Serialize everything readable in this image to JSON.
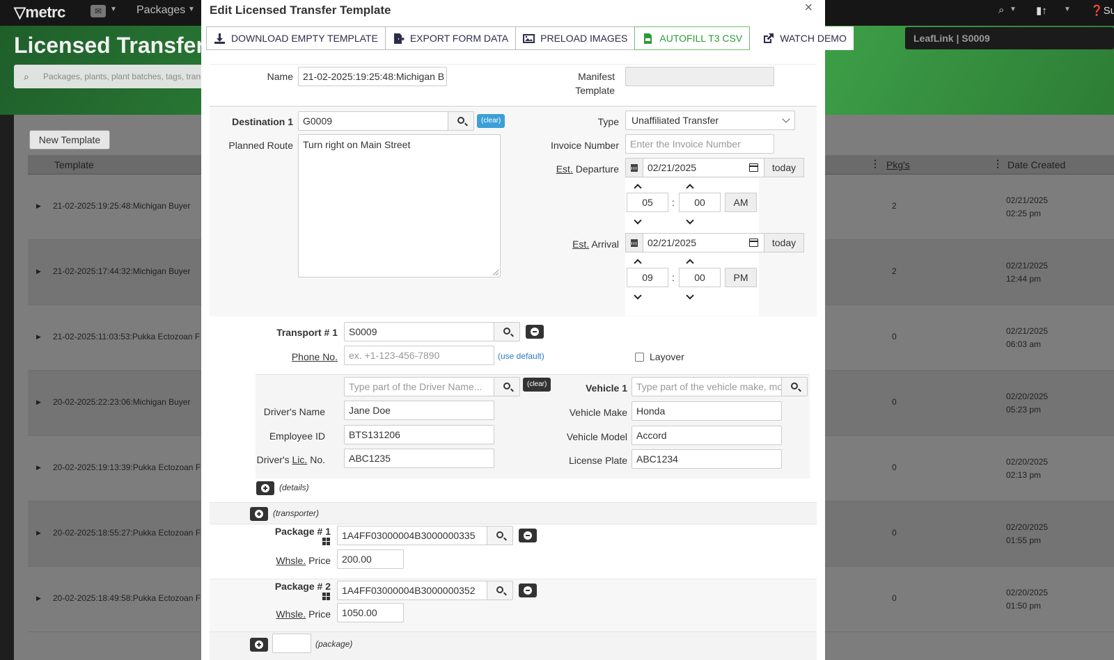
{
  "app": {
    "logo": "metrc",
    "nav_packages": "Packages",
    "page_title": "Licensed Transfer",
    "search_placeholder": "Packages, plants, plant batches, tags, transfers",
    "facility": "LeafLink | S0009",
    "user_short": "Su"
  },
  "grid": {
    "new_template_label": "New Template",
    "col_template": "Template",
    "col_pkgs": "Pkg's",
    "col_date_created": "Date Created",
    "rows": [
      {
        "name": "21-02-2025:19:25:48:Michigan Buyer",
        "pkgs": "2",
        "date": "02/21/2025",
        "time": "02:25 pm"
      },
      {
        "name": "21-02-2025:17:44:32:Michigan Buyer",
        "pkgs": "2",
        "date": "02/21/2025",
        "time": "12:44 pm"
      },
      {
        "name": "21-02-2025:11:03:53:Pukka Ectozoan F",
        "pkgs": "0",
        "date": "02/21/2025",
        "time": "06:03 am"
      },
      {
        "name": "20-02-2025:22:23:06:Michigan Buyer",
        "pkgs": "0",
        "date": "02/20/2025",
        "time": "05:23 pm"
      },
      {
        "name": "20-02-2025:19:13:39:Pukka Ectozoan F",
        "pkgs": "0",
        "date": "02/20/2025",
        "time": "02:13 pm"
      },
      {
        "name": "20-02-2025:18:55:27:Pukka Ectozoan F",
        "pkgs": "0",
        "date": "02/20/2025",
        "time": "01:55 pm"
      },
      {
        "name": "20-02-2025:18:49:58:Pukka Ectozoan F",
        "pkgs": "0",
        "date": "02/20/2025",
        "time": "01:50 pm"
      }
    ]
  },
  "modal": {
    "title": "Edit Licensed Transfer Template",
    "close": "×",
    "toolbar": {
      "download": "DOWNLOAD EMPTY TEMPLATE",
      "export": "EXPORT FORM DATA",
      "preload": "PRELOAD IMAGES",
      "autofill": "AUTOFILL T3 CSV",
      "watch": "WATCH DEMO"
    },
    "name_label": "Name",
    "name_value": "21-02-2025:19:25:48:Michigan B",
    "manifest_label_1": "Manifest",
    "manifest_label_2": "Template",
    "destination_label": "Destination 1",
    "destination_value": "G0009",
    "clear": "(clear)",
    "type_label": "Type",
    "type_value": "Unaffiliated Transfer",
    "route_label": "Planned Route",
    "route_value": "Turn right on Main Street",
    "invoice_label": "Invoice Number",
    "invoice_placeholder": "Enter the Invoice Number",
    "departure_label_ab": "Est.",
    "departure_label": "Departure",
    "departure_date": "02/21/2025",
    "today": "today",
    "dep_hour": "05",
    "dep_min": "00",
    "dep_ampm": "AM",
    "arrival_label": "Arrival",
    "arrival_date": "02/21/2025",
    "arr_hour": "09",
    "arr_min": "00",
    "arr_ampm": "PM",
    "colon": ":",
    "transport_label": "Transport # 1",
    "transport_value": "S0009",
    "phone_label": "Phone No.",
    "phone_placeholder": "ex. +1-123-456-7890",
    "use_default": "(use default)",
    "layover": "Layover",
    "driver_search_placeholder": "Type part of the Driver Name...",
    "vehicle_label": "Vehicle 1",
    "vehicle_search_placeholder": "Type part of the vehicle make, model",
    "driver_name_label": "Driver's Name",
    "driver_name_value": "Jane Doe",
    "employee_id_label": "Employee ID",
    "employee_id_value": "BTS131206",
    "lic_label_a": "Driver's",
    "lic_label_b": "Lic.",
    "lic_label_c": "No.",
    "lic_value": "ABC1235",
    "vehicle_make_label": "Vehicle Make",
    "vehicle_make_value": "Honda",
    "vehicle_model_label": "Vehicle Model",
    "vehicle_model_value": "Accord",
    "plate_label": "License Plate",
    "plate_value": "ABC1234",
    "details_note": "(details)",
    "transporter_note": "(transporter)",
    "pkg1_label": "Package # 1",
    "pkg1_value": "1A4FF03000004B3000000335",
    "price_label_a": "Whsle.",
    "price_label_b": "Price",
    "pkg1_price": "200.00",
    "pkg2_label": "Package # 2",
    "pkg2_value": "1A4FF03000004B3000000352",
    "pkg2_price": "1050.00",
    "package_note": "(package)"
  }
}
